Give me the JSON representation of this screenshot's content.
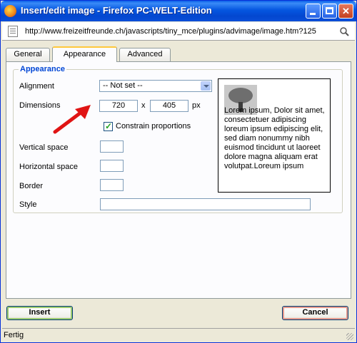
{
  "window": {
    "title": "Insert/edit image - Firefox PC-WELT-Edition"
  },
  "address_bar": {
    "url": "http://www.freizeitfreunde.ch/javascripts/tiny_mce/plugins/advimage/image.htm?125"
  },
  "tabs": [
    {
      "label": "General"
    },
    {
      "label": "Appearance",
      "active": true
    },
    {
      "label": "Advanced"
    }
  ],
  "appearance": {
    "legend": "Appearance",
    "alignment_label": "Alignment",
    "alignment_value": "-- Not set --",
    "dimensions_label": "Dimensions",
    "width": "720",
    "times": "x",
    "height": "405",
    "unit": "px",
    "constrain_label": "Constrain proportions",
    "constrain_checked": true,
    "vspace_label": "Vertical space",
    "hspace_label": "Horizontal space",
    "border_label": "Border",
    "style_label": "Style",
    "preview_text": "Lorem ipsum, Dolor sit amet, consectetuer adipiscing loreum ipsum edipiscing elit, sed diam nonummy nibh euismod tincidunt ut laoreet dolore magna aliquam erat volutpat.Loreum ipsum"
  },
  "buttons": {
    "insert": "Insert",
    "cancel": "Cancel"
  },
  "status": {
    "text": "Fertig"
  },
  "colors": {
    "titlebar": "#0556E0",
    "legend": "#0046D5",
    "annotation_arrow": "#E01414"
  },
  "icons": [
    "firefox-icon",
    "minimize-icon",
    "maximize-icon",
    "close-icon",
    "page-icon",
    "search-icon",
    "dropdown-arrow-icon",
    "checkmark-icon",
    "tree-image-icon",
    "annotation-arrow-icon",
    "resize-grip-icon"
  ]
}
